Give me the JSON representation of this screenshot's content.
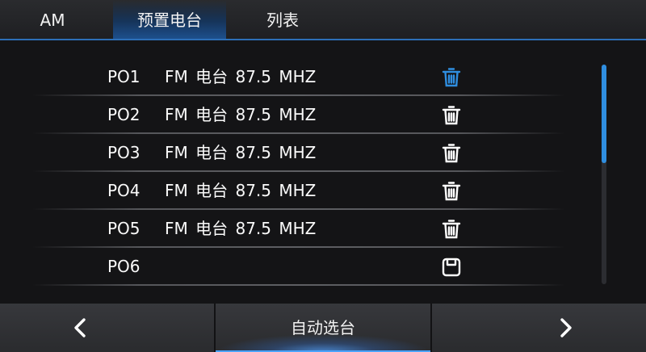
{
  "tabs": [
    {
      "label": "AM",
      "active": false
    },
    {
      "label": "预置电台",
      "active": true
    },
    {
      "label": "列表",
      "active": false
    }
  ],
  "presets": [
    {
      "number": "PO1",
      "station": "FM 电台 87.5 MHZ",
      "action_icon": "trash-icon",
      "highlighted": true
    },
    {
      "number": "PO2",
      "station": "FM 电台 87.5 MHZ",
      "action_icon": "trash-icon",
      "highlighted": false
    },
    {
      "number": "PO3",
      "station": "FM 电台 87.5 MHZ",
      "action_icon": "trash-icon",
      "highlighted": false
    },
    {
      "number": "PO4",
      "station": "FM 电台 87.5 MHZ",
      "action_icon": "trash-icon",
      "highlighted": false
    },
    {
      "number": "PO5",
      "station": "FM 电台 87.5 MHZ",
      "action_icon": "trash-icon",
      "highlighted": false
    },
    {
      "number": "PO6",
      "station": "",
      "action_icon": "save-icon",
      "highlighted": false
    }
  ],
  "bottom": {
    "prev_icon": "chevron-left-icon",
    "auto_scan_label": "自动选台",
    "next_icon": "chevron-right-icon"
  },
  "colors": {
    "accent": "#2f8ee0",
    "background": "#141416",
    "text": "#ffffff"
  }
}
